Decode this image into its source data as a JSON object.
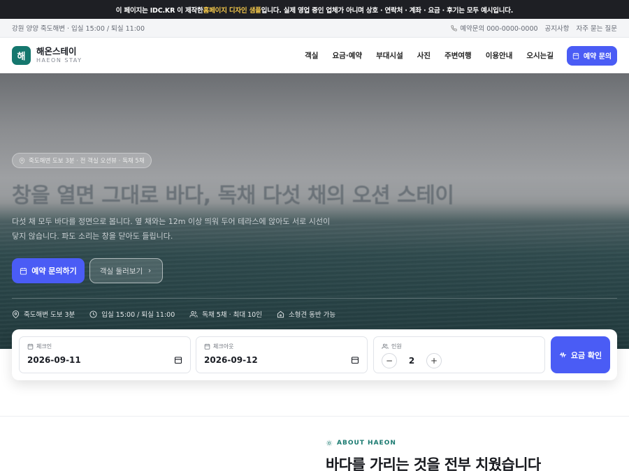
{
  "notice": {
    "prefix": "이 페이지는 IDC.KR 이 제작한 ",
    "highlight": "홈페이지 디자인 샘플",
    "suffix": "입니다. 실제 영업 중인 업체가 아니며 상호 · 연락처 · 계좌 · 요금 · 후기는 모두 예시입니다."
  },
  "util": {
    "left": "강원 양양 죽도해변 · 입실 15:00 / 퇴실 11:00",
    "phone": "예약문의 000-0000-0000",
    "notice_link": "공지사항",
    "faq_link": "자주 묻는 질문"
  },
  "header": {
    "logo_mark": "해",
    "name": "해온스테이",
    "sub": "HAEON STAY",
    "nav": [
      "객실",
      "요금·예약",
      "부대시설",
      "사진",
      "주변여행",
      "이용안내",
      "오시는길"
    ],
    "cta": "예약 문의"
  },
  "hero": {
    "pill": "죽도해변 도보 3분 · 전 객실 오션뷰 · 독채 5채",
    "title": "창을 열면 그대로 바다, 독채 다섯 채의 오션 스테이",
    "desc": "다섯 채 모두 바다를 정면으로 봅니다. 옆 채와는 12m 이상 띄워 두어 테라스에 앉아도 서로 시선이 닿지 않습니다. 파도 소리는 창을 닫아도 들립니다.",
    "primary_cta": "예약 문의하기",
    "secondary_cta": "객실 둘러보기",
    "facts": [
      "죽도해변 도보 3분",
      "입실 15:00 / 퇴실 11:00",
      "독채 5채 · 최대 10인",
      "소형견 동반 가능"
    ]
  },
  "booking": {
    "checkin_label": "체크인",
    "checkin_value": "2026-09-11",
    "checkout_label": "체크아웃",
    "checkout_value": "2026-09-12",
    "guests_label": "인원",
    "guests_value": "2",
    "minus": "−",
    "plus": "+",
    "submit": "요금 확인"
  },
  "about": {
    "eyebrow": "ABOUT HAEON",
    "title": "바다를 가리는 것을 전부 치웠습니다"
  },
  "colors": {
    "accent": "#4a5cf5",
    "brand": "#15776e",
    "notice_bg": "#1e1f24",
    "notice_highlight": "#f4c84a"
  }
}
